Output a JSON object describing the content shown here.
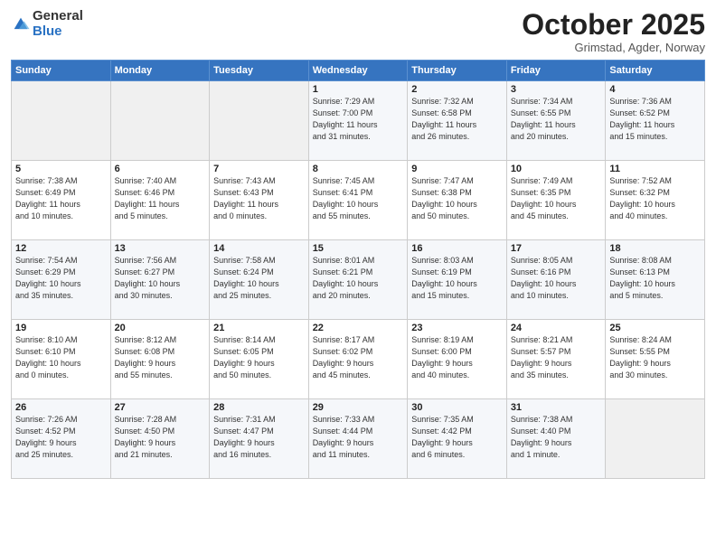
{
  "logo": {
    "general": "General",
    "blue": "Blue"
  },
  "title": "October 2025",
  "location": "Grimstad, Agder, Norway",
  "days_of_week": [
    "Sunday",
    "Monday",
    "Tuesday",
    "Wednesday",
    "Thursday",
    "Friday",
    "Saturday"
  ],
  "weeks": [
    [
      {
        "day": "",
        "info": ""
      },
      {
        "day": "",
        "info": ""
      },
      {
        "day": "",
        "info": ""
      },
      {
        "day": "1",
        "info": "Sunrise: 7:29 AM\nSunset: 7:00 PM\nDaylight: 11 hours\nand 31 minutes."
      },
      {
        "day": "2",
        "info": "Sunrise: 7:32 AM\nSunset: 6:58 PM\nDaylight: 11 hours\nand 26 minutes."
      },
      {
        "day": "3",
        "info": "Sunrise: 7:34 AM\nSunset: 6:55 PM\nDaylight: 11 hours\nand 20 minutes."
      },
      {
        "day": "4",
        "info": "Sunrise: 7:36 AM\nSunset: 6:52 PM\nDaylight: 11 hours\nand 15 minutes."
      }
    ],
    [
      {
        "day": "5",
        "info": "Sunrise: 7:38 AM\nSunset: 6:49 PM\nDaylight: 11 hours\nand 10 minutes."
      },
      {
        "day": "6",
        "info": "Sunrise: 7:40 AM\nSunset: 6:46 PM\nDaylight: 11 hours\nand 5 minutes."
      },
      {
        "day": "7",
        "info": "Sunrise: 7:43 AM\nSunset: 6:43 PM\nDaylight: 11 hours\nand 0 minutes."
      },
      {
        "day": "8",
        "info": "Sunrise: 7:45 AM\nSunset: 6:41 PM\nDaylight: 10 hours\nand 55 minutes."
      },
      {
        "day": "9",
        "info": "Sunrise: 7:47 AM\nSunset: 6:38 PM\nDaylight: 10 hours\nand 50 minutes."
      },
      {
        "day": "10",
        "info": "Sunrise: 7:49 AM\nSunset: 6:35 PM\nDaylight: 10 hours\nand 45 minutes."
      },
      {
        "day": "11",
        "info": "Sunrise: 7:52 AM\nSunset: 6:32 PM\nDaylight: 10 hours\nand 40 minutes."
      }
    ],
    [
      {
        "day": "12",
        "info": "Sunrise: 7:54 AM\nSunset: 6:29 PM\nDaylight: 10 hours\nand 35 minutes."
      },
      {
        "day": "13",
        "info": "Sunrise: 7:56 AM\nSunset: 6:27 PM\nDaylight: 10 hours\nand 30 minutes."
      },
      {
        "day": "14",
        "info": "Sunrise: 7:58 AM\nSunset: 6:24 PM\nDaylight: 10 hours\nand 25 minutes."
      },
      {
        "day": "15",
        "info": "Sunrise: 8:01 AM\nSunset: 6:21 PM\nDaylight: 10 hours\nand 20 minutes."
      },
      {
        "day": "16",
        "info": "Sunrise: 8:03 AM\nSunset: 6:19 PM\nDaylight: 10 hours\nand 15 minutes."
      },
      {
        "day": "17",
        "info": "Sunrise: 8:05 AM\nSunset: 6:16 PM\nDaylight: 10 hours\nand 10 minutes."
      },
      {
        "day": "18",
        "info": "Sunrise: 8:08 AM\nSunset: 6:13 PM\nDaylight: 10 hours\nand 5 minutes."
      }
    ],
    [
      {
        "day": "19",
        "info": "Sunrise: 8:10 AM\nSunset: 6:10 PM\nDaylight: 10 hours\nand 0 minutes."
      },
      {
        "day": "20",
        "info": "Sunrise: 8:12 AM\nSunset: 6:08 PM\nDaylight: 9 hours\nand 55 minutes."
      },
      {
        "day": "21",
        "info": "Sunrise: 8:14 AM\nSunset: 6:05 PM\nDaylight: 9 hours\nand 50 minutes."
      },
      {
        "day": "22",
        "info": "Sunrise: 8:17 AM\nSunset: 6:02 PM\nDaylight: 9 hours\nand 45 minutes."
      },
      {
        "day": "23",
        "info": "Sunrise: 8:19 AM\nSunset: 6:00 PM\nDaylight: 9 hours\nand 40 minutes."
      },
      {
        "day": "24",
        "info": "Sunrise: 8:21 AM\nSunset: 5:57 PM\nDaylight: 9 hours\nand 35 minutes."
      },
      {
        "day": "25",
        "info": "Sunrise: 8:24 AM\nSunset: 5:55 PM\nDaylight: 9 hours\nand 30 minutes."
      }
    ],
    [
      {
        "day": "26",
        "info": "Sunrise: 7:26 AM\nSunset: 4:52 PM\nDaylight: 9 hours\nand 25 minutes."
      },
      {
        "day": "27",
        "info": "Sunrise: 7:28 AM\nSunset: 4:50 PM\nDaylight: 9 hours\nand 21 minutes."
      },
      {
        "day": "28",
        "info": "Sunrise: 7:31 AM\nSunset: 4:47 PM\nDaylight: 9 hours\nand 16 minutes."
      },
      {
        "day": "29",
        "info": "Sunrise: 7:33 AM\nSunset: 4:44 PM\nDaylight: 9 hours\nand 11 minutes."
      },
      {
        "day": "30",
        "info": "Sunrise: 7:35 AM\nSunset: 4:42 PM\nDaylight: 9 hours\nand 6 minutes."
      },
      {
        "day": "31",
        "info": "Sunrise: 7:38 AM\nSunset: 4:40 PM\nDaylight: 9 hours\nand 1 minute."
      },
      {
        "day": "",
        "info": ""
      }
    ]
  ]
}
